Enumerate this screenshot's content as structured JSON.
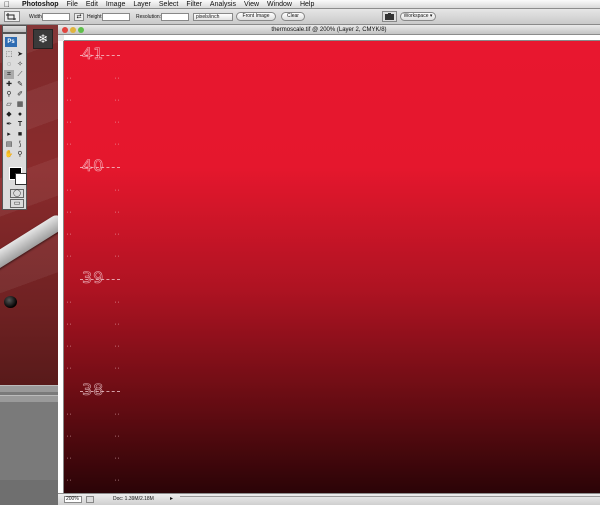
{
  "menubar": {
    "items": [
      "Photoshop",
      "File",
      "Edit",
      "Image",
      "Layer",
      "Select",
      "Filter",
      "Analysis",
      "View",
      "Window",
      "Help"
    ]
  },
  "options_bar": {
    "width_label": "Width:",
    "height_label": "Height:",
    "resolution_label": "Resolution:",
    "units_value": "pixels/inch",
    "front_image_button": "Front Image",
    "clear_button": "Clear",
    "workspace_label": "Workspace ▾"
  },
  "toolbox": {
    "logo": "Ps"
  },
  "document": {
    "title": "thermoscale.tif @ 200% (Layer 2, CMYK/8)",
    "scale_numbers": [
      "41",
      "40",
      "39",
      "38"
    ],
    "zoom": "200%",
    "doc_info": "Doc: 1.39M/2.18M"
  },
  "colors": {
    "canvas_top": "#e8172f",
    "canvas_bottom": "#2b0407",
    "scene": "#7c2a2b"
  }
}
